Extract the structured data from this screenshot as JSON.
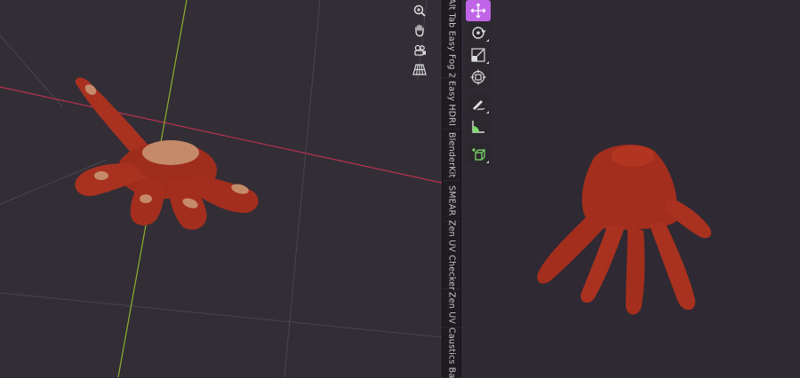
{
  "viewport": {
    "background": "#332d35",
    "x_axis_color": "#b8334f",
    "y_axis_color": "#8bb12e",
    "grid_color": "#4a4450"
  },
  "nav_gizmo": [
    {
      "name": "zoom",
      "icon": "zoom-in-icon"
    },
    {
      "name": "pan",
      "icon": "hand-icon"
    },
    {
      "name": "camera",
      "icon": "camera-view-icon"
    },
    {
      "name": "perspective",
      "icon": "grid-perspective-icon"
    }
  ],
  "sidebar_tabs": [
    {
      "label": "Alt Tab Easy Fog 2"
    },
    {
      "label": "Easy HDRI"
    },
    {
      "label": "BlenderKit"
    },
    {
      "label": "SMEAR"
    },
    {
      "label": "Zen UV Checker"
    },
    {
      "label": "Zen UV"
    },
    {
      "label": "Caustics Ba"
    }
  ],
  "toolbar": [
    {
      "name": "move",
      "icon": "move-icon",
      "active": true
    },
    {
      "name": "rotate",
      "icon": "rotate-icon",
      "active": false
    },
    {
      "name": "scale",
      "icon": "scale-icon",
      "active": false
    },
    {
      "name": "transform",
      "icon": "transform-icon",
      "active": false
    },
    {
      "name": "annotate",
      "icon": "annotate-icon",
      "active": false
    },
    {
      "name": "measure",
      "icon": "measure-icon",
      "active": false
    },
    {
      "name": "add-cube",
      "icon": "add-cube-icon",
      "active": false
    }
  ],
  "colors": {
    "hand_skin": "#a8311f",
    "hand_skin_dark": "#7a2012",
    "nail": "#c58a6a",
    "tool_active": "#c065e8"
  }
}
